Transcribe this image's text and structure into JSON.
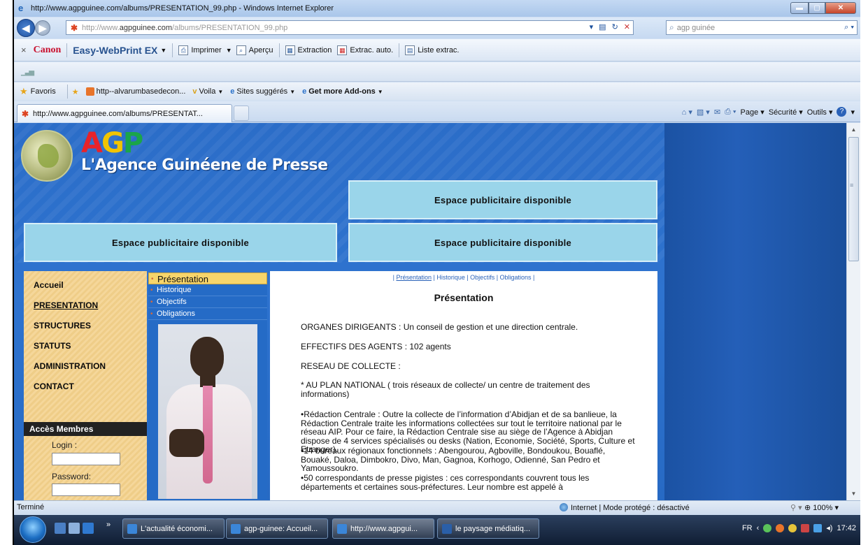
{
  "window": {
    "title": "http://www.agpguinee.com/albums/PRESENTATION_99.php - Windows Internet Explorer"
  },
  "address": {
    "url_prefix": "http://www.",
    "url_domain": "agpguinee.com",
    "url_path": "/albums/PRESENTATION_99.php",
    "search_value": "agp guinée"
  },
  "canon_toolbar": {
    "brand": "Canon",
    "product": "Easy-WebPrint EX",
    "imprimer": "Imprimer",
    "apercu": "Aperçu",
    "extraction": "Extraction",
    "extrac_auto": "Extrac. auto.",
    "liste_extrac": "Liste extrac."
  },
  "favorites": {
    "label": "Favoris",
    "items": [
      "http--alvarumbasedecon...",
      "Voila",
      "Sites suggérés",
      "Get more Add-ons"
    ]
  },
  "tab": {
    "title": "http://www.agpguinee.com/albums/PRESENTAT..."
  },
  "command_bar": {
    "page": "Page",
    "securite": "Sécurité",
    "outils": "Outils"
  },
  "site": {
    "logo": {
      "a": "A",
      "g": "G",
      "p": "P"
    },
    "subtitle": "L'Agence Guinéene de Presse",
    "ad_text": "Espace publicitaire disponible",
    "menu": [
      "Accueil",
      "PRESENTATION",
      "STRUCTURES",
      "STATUTS",
      "ADMINISTRATION",
      "CONTACT"
    ],
    "members": {
      "title": "Accès Membres",
      "login_label": "Login :",
      "password_label": "Password:"
    },
    "submenu": [
      "Présentation",
      "Historique",
      "Objectifs",
      "Obligations"
    ],
    "crumbs": {
      "presentation": "Présentation",
      "rest": " | Historique | Objectifs | Obligations |",
      "lead": "| "
    },
    "article": {
      "title": "Présentation",
      "p1": "ORGANES DIRIGEANTS : Un conseil de gestion et une direction centrale.",
      "p2": "EFFECTIFS DES AGENTS : 102 agents",
      "p3": "RESEAU DE COLLECTE :",
      "p4": "* AU PLAN NATIONAL ( trois réseaux de collecte/ un centre de traitement des informations)",
      "p5": "•Rédaction Centrale : Outre la collecte de l’information d’Abidjan et de sa banlieue, la Rédaction Centrale traite les informations collectées sur tout le territoire national par le réseau AIP. Pour ce faire, la Rédaction Centrale sise au siège de l’Agence à Abidjan dispose de 4 services spécialisés ou desks (Nation, Economie, Société, Sports, Culture et Etranger).",
      "p6": "•14 bureaux régionaux fonctionnels : Abengourou, Agboville, Bondoukou, Bouaflé, Bouaké, Daloa, Dimbokro, Divo, Man, Gagnoa, Korhogo, Odienné, San Pedro et Yamoussoukro.",
      "p7": "•50 correspondants de presse pigistes : ces correspondants couvrent tous les départements et certaines sous-préfectures. Leur nombre est appelé à"
    }
  },
  "status": {
    "text": "Terminé",
    "zone": "Internet | Mode protégé : désactivé",
    "zoom": "100%"
  },
  "taskbar": {
    "buttons": [
      "L'actualité économi...",
      "agp-guinee: Accueil...",
      "http://www.agpgui...",
      "le paysage médiatiq..."
    ],
    "lang": "FR",
    "clock": "17:42"
  },
  "colors": {
    "site_blue": "#2e73cf",
    "ad_box": "#9ad5ea",
    "menu_bg": "#f5d79a",
    "accent_red": "#e8232a"
  }
}
